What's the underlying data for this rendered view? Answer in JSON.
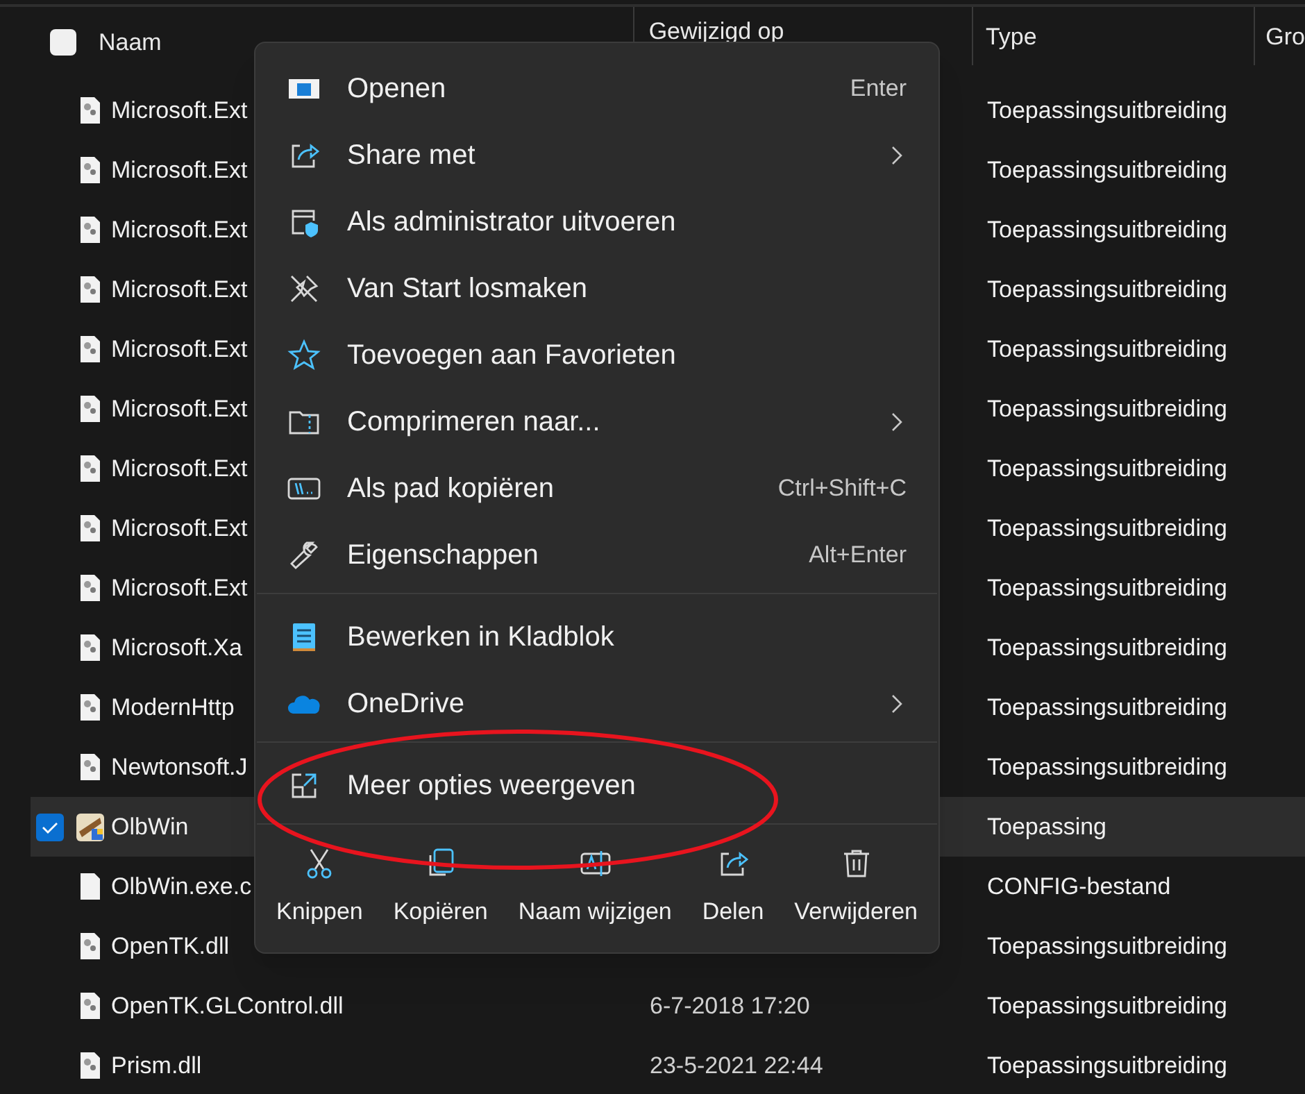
{
  "header": {
    "select_all": {
      "checked": false
    },
    "columns": [
      "Naam",
      "Gewijzigd op",
      "Type",
      "Gro"
    ]
  },
  "rows": [
    {
      "name": "Microsoft.Ext",
      "type": "Toepassingsuitbreiding",
      "kind": "dll",
      "selected": false
    },
    {
      "name": "Microsoft.Ext",
      "type": "Toepassingsuitbreiding",
      "kind": "dll",
      "selected": false
    },
    {
      "name": "Microsoft.Ext",
      "type": "Toepassingsuitbreiding",
      "kind": "dll",
      "selected": false
    },
    {
      "name": "Microsoft.Ext",
      "type": "Toepassingsuitbreiding",
      "kind": "dll",
      "selected": false
    },
    {
      "name": "Microsoft.Ext",
      "type": "Toepassingsuitbreiding",
      "kind": "dll",
      "selected": false
    },
    {
      "name": "Microsoft.Ext",
      "type": "Toepassingsuitbreiding",
      "kind": "dll",
      "selected": false
    },
    {
      "name": "Microsoft.Ext",
      "type": "Toepassingsuitbreiding",
      "kind": "dll",
      "selected": false
    },
    {
      "name": "Microsoft.Ext",
      "type": "Toepassingsuitbreiding",
      "kind": "dll",
      "selected": false
    },
    {
      "name": "Microsoft.Ext",
      "type": "Toepassingsuitbreiding",
      "kind": "dll",
      "selected": false
    },
    {
      "name": "Microsoft.Xa",
      "type": "Toepassingsuitbreiding",
      "kind": "dll",
      "selected": false
    },
    {
      "name": "ModernHttp",
      "type": "Toepassingsuitbreiding",
      "kind": "dll",
      "selected": false
    },
    {
      "name": "Newtonsoft.J",
      "type": "Toepassingsuitbreiding",
      "kind": "dll",
      "selected": false
    },
    {
      "name": "OlbWin",
      "type": "Toepassing",
      "kind": "app",
      "selected": true
    },
    {
      "name": "OlbWin.exe.c",
      "type": "CONFIG-bestand",
      "kind": "blank",
      "selected": false
    },
    {
      "name": "OpenTK.dll",
      "type": "Toepassingsuitbreiding",
      "kind": "dll",
      "selected": false
    },
    {
      "name": "OpenTK.GLControl.dll",
      "modified": "6-7-2018 17:20",
      "type": "Toepassingsuitbreiding",
      "kind": "dll",
      "selected": false
    },
    {
      "name": "Prism.dll",
      "modified": "23-5-2021 22:44",
      "type": "Toepassingsuitbreiding",
      "kind": "dll",
      "selected": false
    }
  ],
  "context_menu": {
    "groups": [
      [
        {
          "label": "Openen",
          "kind": "open",
          "shortcut": "Enter",
          "submenu": false
        },
        {
          "label": "Share met",
          "kind": "share",
          "submenu": true
        },
        {
          "label": "Als administrator uitvoeren",
          "kind": "admin",
          "submenu": false
        },
        {
          "label": "Van Start losmaken",
          "kind": "unpin",
          "submenu": false
        },
        {
          "label": "Toevoegen aan Favorieten",
          "kind": "star",
          "submenu": false
        },
        {
          "label": "Comprimeren naar...",
          "kind": "zip",
          "submenu": true
        },
        {
          "label": "Als pad kopiëren",
          "kind": "path",
          "shortcut": "Ctrl+Shift+C",
          "submenu": false
        },
        {
          "label": "Eigenschappen",
          "kind": "wrench",
          "shortcut": "Alt+Enter",
          "submenu": false
        }
      ],
      [
        {
          "label": "Bewerken in Kladblok",
          "kind": "notepad",
          "submenu": false
        },
        {
          "label": "OneDrive",
          "kind": "cloud",
          "submenu": true
        }
      ],
      [
        {
          "label": "Meer opties weergeven",
          "kind": "more",
          "submenu": false
        }
      ]
    ],
    "actions": [
      {
        "label": "Knippen",
        "kind": "cut"
      },
      {
        "label": "Kopiëren",
        "kind": "copy"
      },
      {
        "label": "Naam wijzigen",
        "kind": "rename"
      },
      {
        "label": "Delen",
        "kind": "share"
      },
      {
        "label": "Verwijderen",
        "kind": "trash"
      }
    ]
  },
  "annotation": {
    "kind": "ellipse"
  }
}
